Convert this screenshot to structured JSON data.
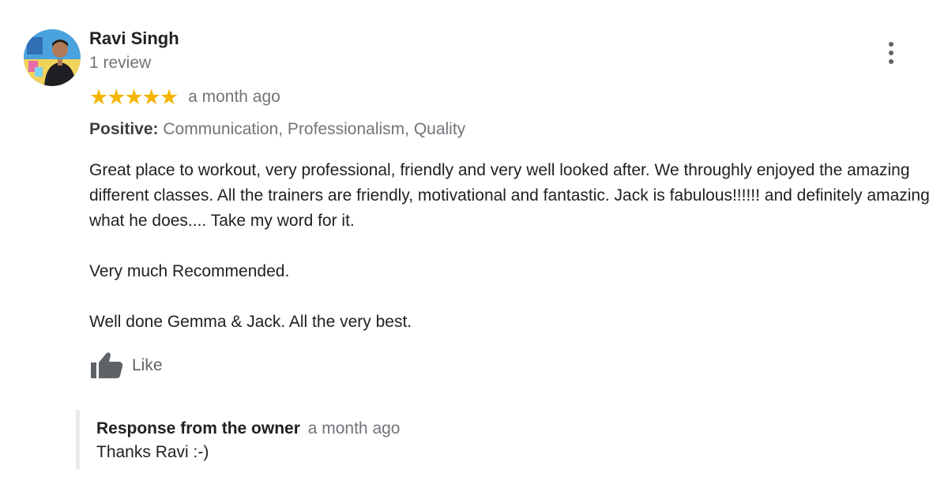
{
  "reviewer": {
    "name": "Ravi Singh",
    "review_count": "1 review"
  },
  "rating": {
    "stars": 5,
    "max": 5,
    "color": "#f4b400",
    "time": "a month ago"
  },
  "positives": {
    "label": "Positive:",
    "items": "Communication, Professionalism, Quality"
  },
  "review": {
    "paragraph_1": "Great place to workout, very professional, friendly and very well looked after. We throughly enjoyed the amazing different classes. All the trainers are friendly, motivational and fantastic. Jack is fabulous!!!!!! and definitely amazing what he does.... Take my word for it.",
    "paragraph_2": "Very much Recommended.",
    "paragraph_3": "Well done Gemma & Jack. All the very best."
  },
  "actions": {
    "like_label": "Like",
    "like_icon": "thumbs-up-icon",
    "more_icon": "more-vertical-icon"
  },
  "owner_response": {
    "title": "Response from the owner",
    "time": "a month ago",
    "text": "Thanks Ravi :-)"
  }
}
